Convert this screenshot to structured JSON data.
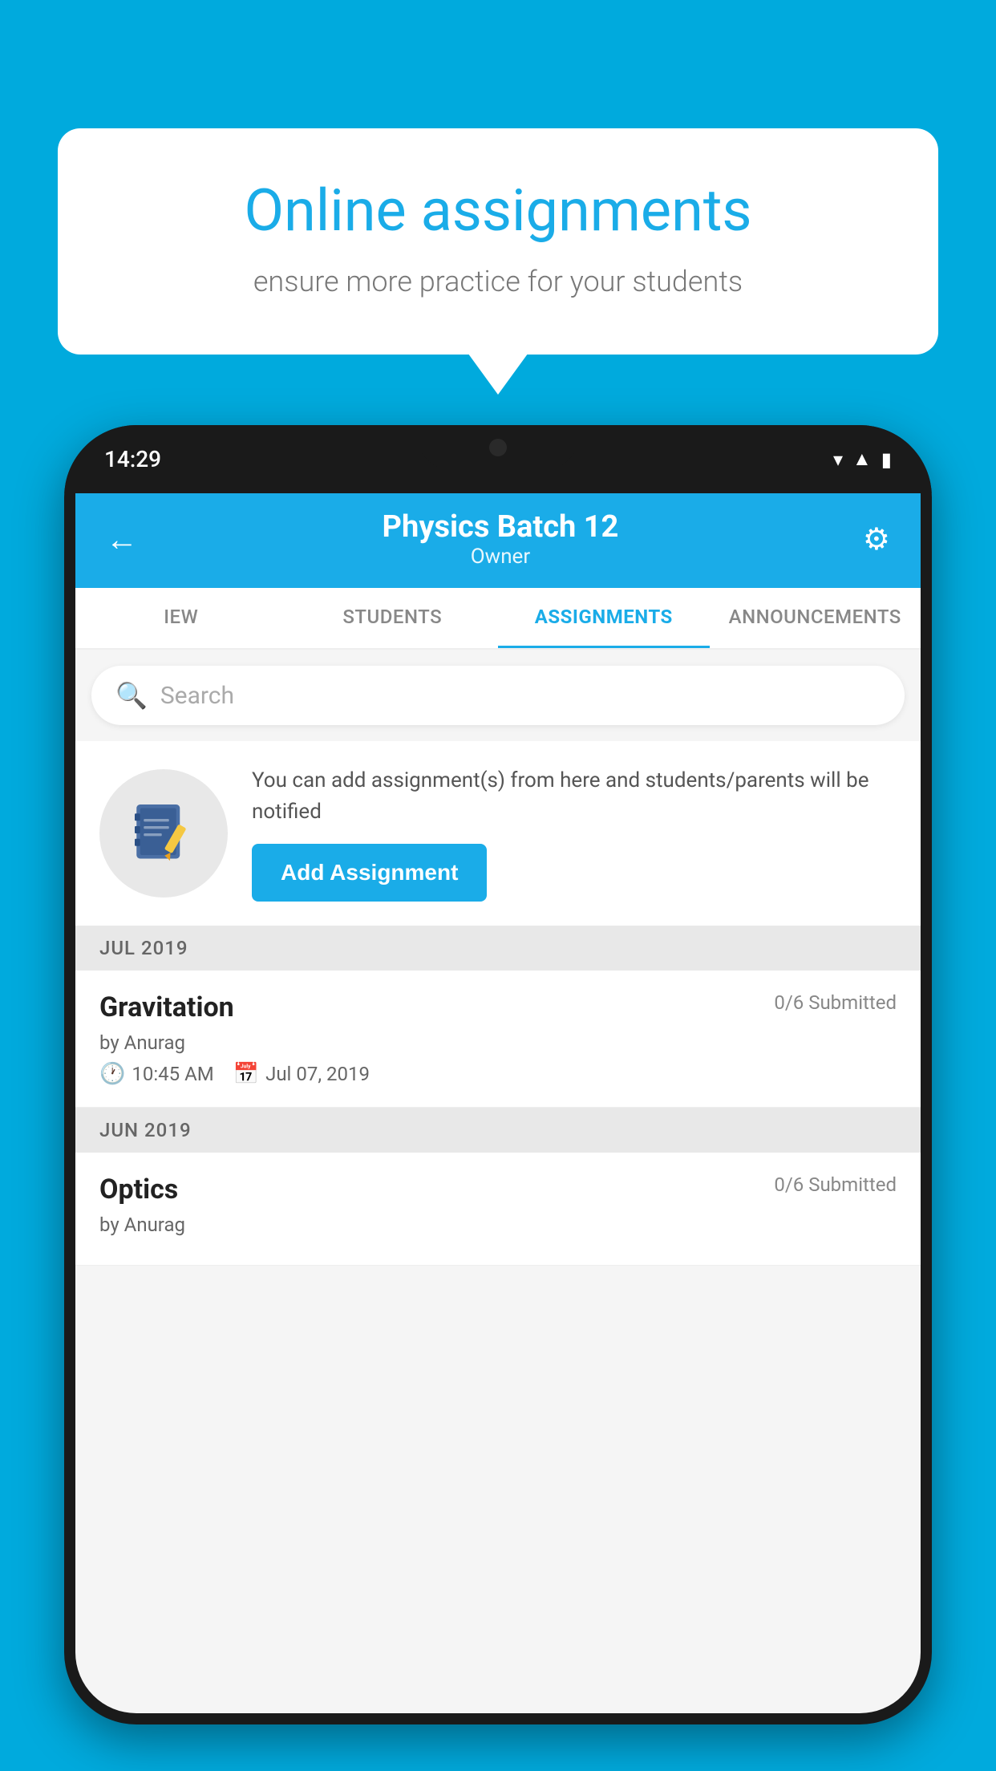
{
  "background_color": "#00AADD",
  "speech_bubble": {
    "title": "Online assignments",
    "subtitle": "ensure more practice for your students"
  },
  "phone": {
    "status_time": "14:29",
    "header": {
      "title": "Physics Batch 12",
      "subtitle": "Owner",
      "back_label": "←",
      "settings_label": "⚙"
    },
    "tabs": [
      {
        "label": "IEW",
        "active": false
      },
      {
        "label": "STUDENTS",
        "active": false
      },
      {
        "label": "ASSIGNMENTS",
        "active": true
      },
      {
        "label": "ANNOUNCEMENTS",
        "active": false
      }
    ],
    "search": {
      "placeholder": "Search"
    },
    "info_card": {
      "text": "You can add assignment(s) from here and students/parents will be notified",
      "button_label": "Add Assignment"
    },
    "sections": [
      {
        "header": "JUL 2019",
        "assignments": [
          {
            "name": "Gravitation",
            "submitted": "0/6 Submitted",
            "by": "by Anurag",
            "time": "10:45 AM",
            "date": "Jul 07, 2019"
          }
        ]
      },
      {
        "header": "JUN 2019",
        "assignments": [
          {
            "name": "Optics",
            "submitted": "0/6 Submitted",
            "by": "by Anurag",
            "time": "",
            "date": ""
          }
        ]
      }
    ]
  }
}
